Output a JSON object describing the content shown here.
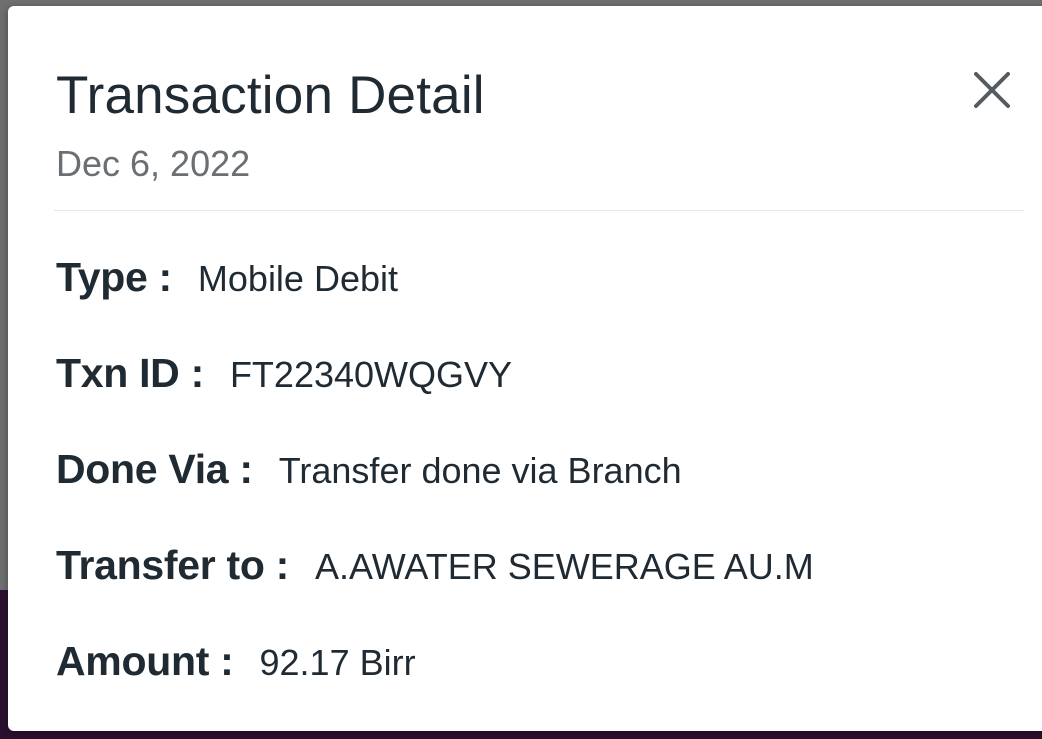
{
  "dialog": {
    "title": "Transaction Detail",
    "date": "Dec 6, 2022",
    "close_icon": "close-icon"
  },
  "details": {
    "type": {
      "label": "Type :",
      "value": "Mobile Debit"
    },
    "txn_id": {
      "label": "Txn ID :",
      "value": "FT22340WQGVY"
    },
    "done_via": {
      "label": "Done Via :",
      "value": "Transfer done via Branch"
    },
    "transfer_to": {
      "label": "Transfer to :",
      "value": "A.AWATER SEWERAGE AU.M"
    },
    "amount": {
      "label": "Amount :",
      "value": "92.17 Birr"
    }
  },
  "colors": {
    "text_primary": "#1f2a33",
    "text_secondary": "#6a6f73",
    "backdrop": "#6f6f6f",
    "backdrop_bottom": "#2a1030"
  }
}
